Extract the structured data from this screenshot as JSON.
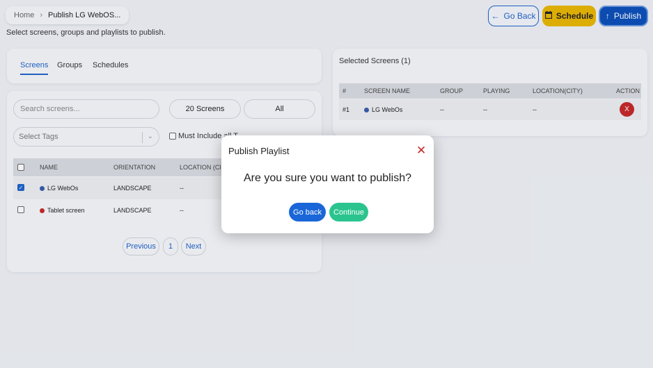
{
  "breadcrumb": {
    "home": "Home",
    "current": "Publish LG WebOS..."
  },
  "subtitle": "Select screens, groups and playlists to publish.",
  "header_buttons": {
    "go_back": "Go Back",
    "schedule": "Schedule",
    "publish": "Publish"
  },
  "tabs": [
    {
      "label": "Screens",
      "active": true
    },
    {
      "label": "Groups",
      "active": false
    },
    {
      "label": "Schedules",
      "active": false
    }
  ],
  "filters": {
    "search_placeholder": "Search screens...",
    "count_label": "20 Screens",
    "all_label": "All",
    "tags_placeholder": "Select Tags",
    "must_include": "Must Include all T"
  },
  "screens_table": {
    "columns": [
      "NAME",
      "ORIENTATION",
      "LOCATION (CITY)"
    ],
    "rows": [
      {
        "name": "LG WebOs",
        "orientation": "LANDSCAPE",
        "location": "--",
        "checked": true,
        "status_color": "#3a5ca8"
      },
      {
        "name": "Tablet screen",
        "orientation": "LANDSCAPE",
        "location": "--",
        "checked": false,
        "status_color": "#c62828"
      }
    ]
  },
  "pagination": {
    "previous": "Previous",
    "page": "1",
    "next": "Next"
  },
  "selected": {
    "title": "Selected Screens (1)",
    "columns": [
      "#",
      "SCREEN NAME",
      "GROUP",
      "PLAYING",
      "LOCATION(CITY)",
      "ACTION"
    ],
    "rows": [
      {
        "index": "#1",
        "name": "LG WebOs",
        "group": "--",
        "playing": "--",
        "location": "--",
        "action": "X"
      }
    ]
  },
  "modal": {
    "title": "Publish Playlist",
    "question": "Are you sure you want to publish?",
    "go_back": "Go back",
    "continue": "Continue"
  },
  "colors": {
    "primary": "#1a66d8",
    "schedule": "#e8b600",
    "danger": "#c62828",
    "success": "#2bc48f"
  }
}
